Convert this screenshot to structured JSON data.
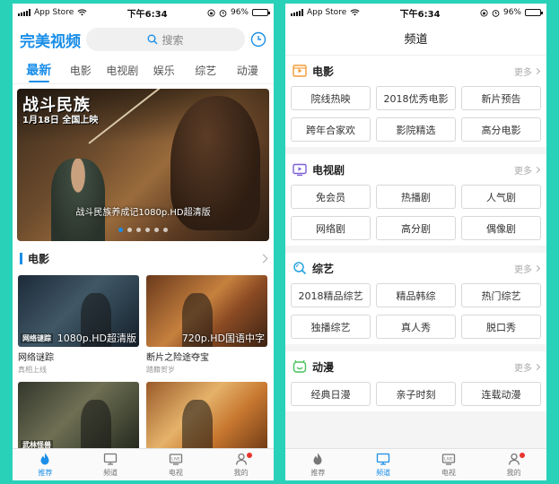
{
  "status_bar": {
    "carrier": "App Store",
    "time": "下午6:34",
    "battery": "96%",
    "battery_level": 0.96
  },
  "left": {
    "logo": "完美视频",
    "search": {
      "placeholder": "搜索"
    },
    "tabs": [
      {
        "label": "最新",
        "active": true
      },
      {
        "label": "电影"
      },
      {
        "label": "电视剧"
      },
      {
        "label": "娱乐"
      },
      {
        "label": "综艺"
      },
      {
        "label": "动漫"
      }
    ],
    "banner": {
      "promo_title": "战斗民族",
      "promo_date": "1月18日 全国上映",
      "caption": "战斗民族养成记1080p.HD超清版",
      "slide_count": 6,
      "active_slide": 0
    },
    "section_title": "电影",
    "cards": [
      {
        "quality": "1080p.HD超清版",
        "tag": "网络谜踪",
        "title": "网络谜踪",
        "subtitle": "真相上线"
      },
      {
        "quality": "720p.HD国语中字",
        "tag": "",
        "title": "断片之险途夺宝",
        "subtitle": "踏籍贺岁"
      },
      {
        "quality": "",
        "tag": "武林怪兽",
        "title": "",
        "subtitle": ""
      },
      {
        "quality": "",
        "tag": "",
        "title": "",
        "subtitle": ""
      }
    ]
  },
  "right": {
    "title": "频道",
    "more_label": "更多",
    "sections": [
      {
        "title": "电影",
        "icon": "film-icon",
        "items": [
          "院线热映",
          "2018优秀电影",
          "新片预告",
          "跨年合家欢",
          "影院精选",
          "高分电影"
        ]
      },
      {
        "title": "电视剧",
        "icon": "tv-icon",
        "items": [
          "免会员",
          "热播剧",
          "人气剧",
          "网络剧",
          "高分剧",
          "偶像剧"
        ]
      },
      {
        "title": "综艺",
        "icon": "variety-search-icon",
        "items": [
          "2018精品综艺",
          "精品韩综",
          "热门综艺",
          "独播综艺",
          "真人秀",
          "脱口秀"
        ]
      },
      {
        "title": "动漫",
        "icon": "anime-icon",
        "items": [
          "经典日漫",
          "亲子时刻",
          "连载动漫"
        ]
      }
    ]
  },
  "tabbar": {
    "items": [
      {
        "label": "推荐",
        "icon": "recommend-icon"
      },
      {
        "label": "频道",
        "icon": "channel-icon"
      },
      {
        "label": "电视",
        "icon": "live-tv-icon"
      },
      {
        "label": "我的",
        "icon": "profile-icon"
      }
    ],
    "left_active": 0,
    "right_active": 1
  },
  "colors": {
    "accent": "#1a8ee8",
    "background": "#2ad1b9",
    "badge": "#e8342e",
    "film_icon": "#f39c35",
    "tv_icon": "#7b5fd6",
    "variety_icon": "#2aa3e0",
    "anime_icon": "#46c45a"
  }
}
